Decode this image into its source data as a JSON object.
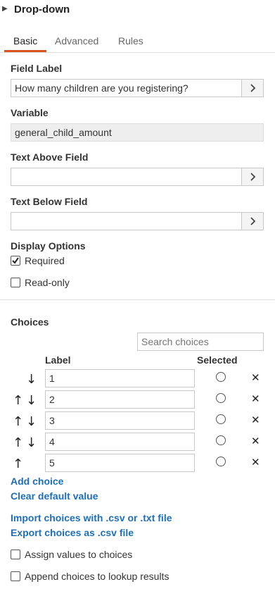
{
  "header": {
    "title": "Drop-down"
  },
  "tabs": [
    {
      "label": "Basic",
      "active": true
    },
    {
      "label": "Advanced",
      "active": false
    },
    {
      "label": "Rules",
      "active": false
    }
  ],
  "fields": {
    "field_label": {
      "label": "Field Label",
      "value": "How many children are you registering?"
    },
    "variable": {
      "label": "Variable",
      "value": "general_child_amount"
    },
    "text_above": {
      "label": "Text Above Field",
      "value": ""
    },
    "text_below": {
      "label": "Text Below Field",
      "value": ""
    }
  },
  "display_options": {
    "label": "Display Options",
    "required": {
      "label": "Required",
      "checked": true
    },
    "readonly": {
      "label": "Read-only",
      "checked": false
    }
  },
  "choices": {
    "heading": "Choices",
    "search_placeholder": "Search choices",
    "col_label": "Label",
    "col_selected": "Selected",
    "items": [
      {
        "value": "1"
      },
      {
        "value": "2"
      },
      {
        "value": "3"
      },
      {
        "value": "4"
      },
      {
        "value": "5"
      }
    ],
    "add_choice": "Add choice",
    "clear_default": "Clear default value",
    "import": "Import choices with .csv or .txt file",
    "export": "Export choices as .csv file",
    "assign_values": "Assign values to choices",
    "append_lookup": "Append choices to lookup results"
  },
  "icons": {
    "expand": "triangle-right-icon",
    "open": "chevron-right-icon",
    "search": "search-icon",
    "up": "arrow-up-icon",
    "down": "arrow-down-icon",
    "remove": "close-icon"
  },
  "colors": {
    "accent": "#d9531e",
    "link": "#1e6fb8"
  }
}
